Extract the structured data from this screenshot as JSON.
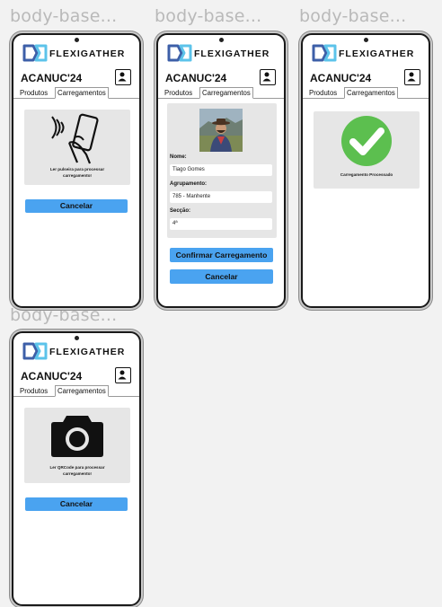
{
  "app": {
    "brand": "FLEXIGATHER",
    "event": "ACANUC'24",
    "tabs": [
      "Produtos",
      "Carregamentos"
    ]
  },
  "frames": [
    {
      "label": "body-base...",
      "panel_text_line1": "Ler pulseira para processar",
      "panel_text_line2": "carregamento!",
      "cancel_label": "Cancelar"
    },
    {
      "label": "body-base...",
      "name_label": "Nome:",
      "name_value": "Tiago Gomes",
      "group_label": "Agrupamento:",
      "group_value": "785 - Manhente",
      "section_label": "Secção:",
      "section_value": "4ª",
      "confirm_label": "Confirmar Carregamento",
      "cancel_label": "Cancelar"
    },
    {
      "label": "body-base...",
      "panel_text": "Carregamento Processado"
    },
    {
      "label": "body-base...",
      "panel_text_line1": "Ler QRCode para processar",
      "panel_text_line2": "carregamento!",
      "cancel_label": "Cancelar"
    }
  ],
  "colors": {
    "accent": "#4aa3f0",
    "success": "#5cbf4f",
    "panel": "#e6e6e6",
    "logo_dark": "#3d5fa8",
    "logo_light": "#5cc3ea"
  },
  "icons": [
    "nfc-phone-icon",
    "avatar-photo",
    "success-check-icon",
    "camera-icon",
    "user-icon"
  ]
}
